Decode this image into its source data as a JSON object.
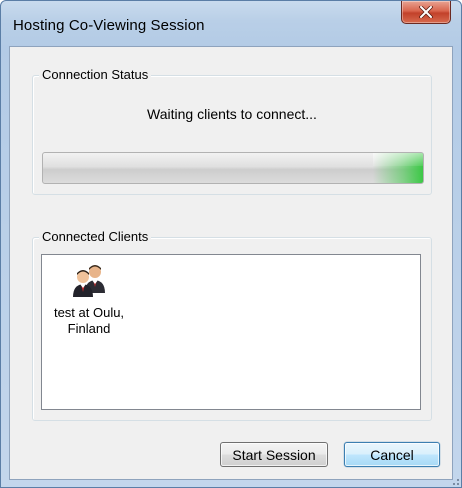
{
  "window": {
    "title": "Hosting Co-Viewing Session"
  },
  "connection_status": {
    "label": "Connection Status",
    "status_text": "Waiting clients to connect...",
    "progress_state": "marquee"
  },
  "connected_clients": {
    "label": "Connected Clients",
    "clients": [
      {
        "name": "test at Oulu,\nFinland",
        "icon": "user-group-icon"
      }
    ]
  },
  "buttons": {
    "start_session": "Start Session",
    "cancel": "Cancel"
  },
  "colors": {
    "progress_accent": "#3cc846",
    "close_button": "#c2412a",
    "default_button_border": "#3c7fb1"
  }
}
